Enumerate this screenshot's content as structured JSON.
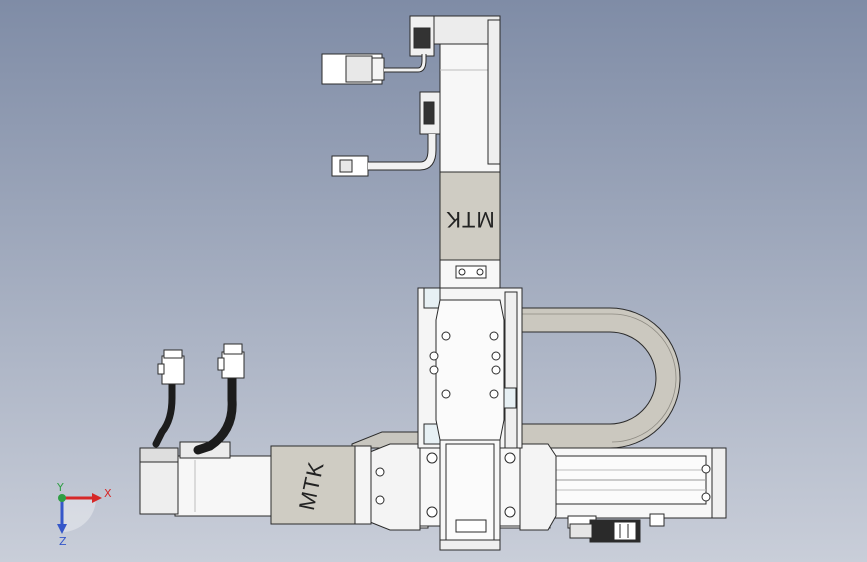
{
  "model": {
    "vertical_module_label": "MTK",
    "horizontal_module_label": "MTK"
  },
  "triad": {
    "x_label": "X",
    "y_label": "Y",
    "z_label": "Z"
  },
  "colors": {
    "background_top": "#7f8ca6",
    "background_bottom": "#c9ced9",
    "body": "#f7f7f7",
    "outline": "#2b2b2b",
    "label_band": "#cfccc3",
    "cable_carrier": "#cbc8bf",
    "cable": "#1c1c1c",
    "axis_x": "#d62828",
    "axis_y": "#2f9e44",
    "axis_z": "#3557c9"
  }
}
